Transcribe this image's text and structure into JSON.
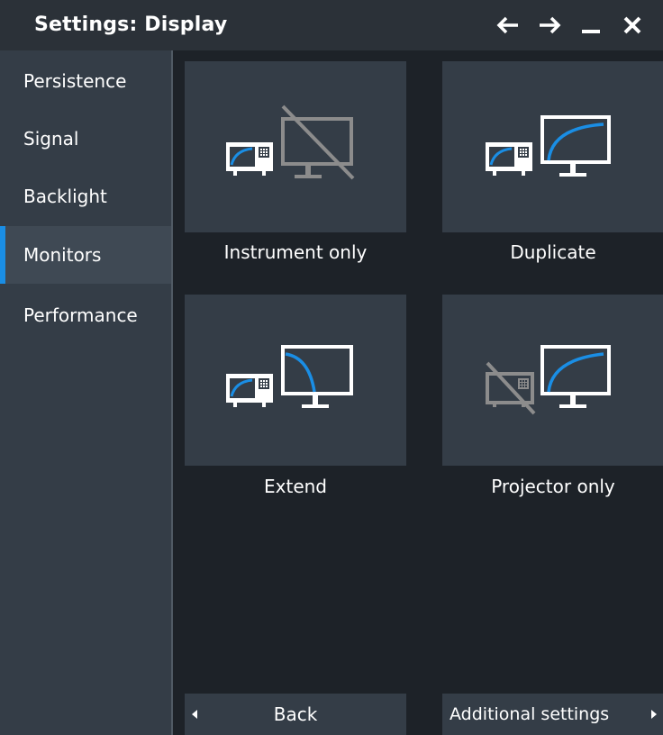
{
  "window": {
    "title": "Settings: Display",
    "controls": {
      "back_icon": "arrow-left-icon",
      "forward_icon": "arrow-right-icon",
      "minimize_icon": "minimize-icon",
      "close_icon": "close-icon"
    }
  },
  "sidebar": {
    "items": [
      {
        "label": "Persistence",
        "active": false
      },
      {
        "label": "Signal",
        "active": false
      },
      {
        "label": "Backlight",
        "active": false
      },
      {
        "label": "Monitors",
        "active": true
      },
      {
        "label": "Performance",
        "active": false
      }
    ]
  },
  "monitors": {
    "options": [
      {
        "label": "Instrument only",
        "icon": "instrument-only-icon"
      },
      {
        "label": "Duplicate",
        "icon": "duplicate-display-icon"
      },
      {
        "label": "Extend",
        "icon": "extend-display-icon"
      },
      {
        "label": "Projector only",
        "icon": "projector-only-icon"
      }
    ]
  },
  "footer": {
    "back_label": "Back",
    "additional_label": "Additional settings"
  },
  "colors": {
    "accent": "#1a8ee5",
    "panel": "#343d47",
    "background": "#1d2228",
    "titlebar": "#2b3138",
    "disabled_icon": "#8c8c8c"
  }
}
